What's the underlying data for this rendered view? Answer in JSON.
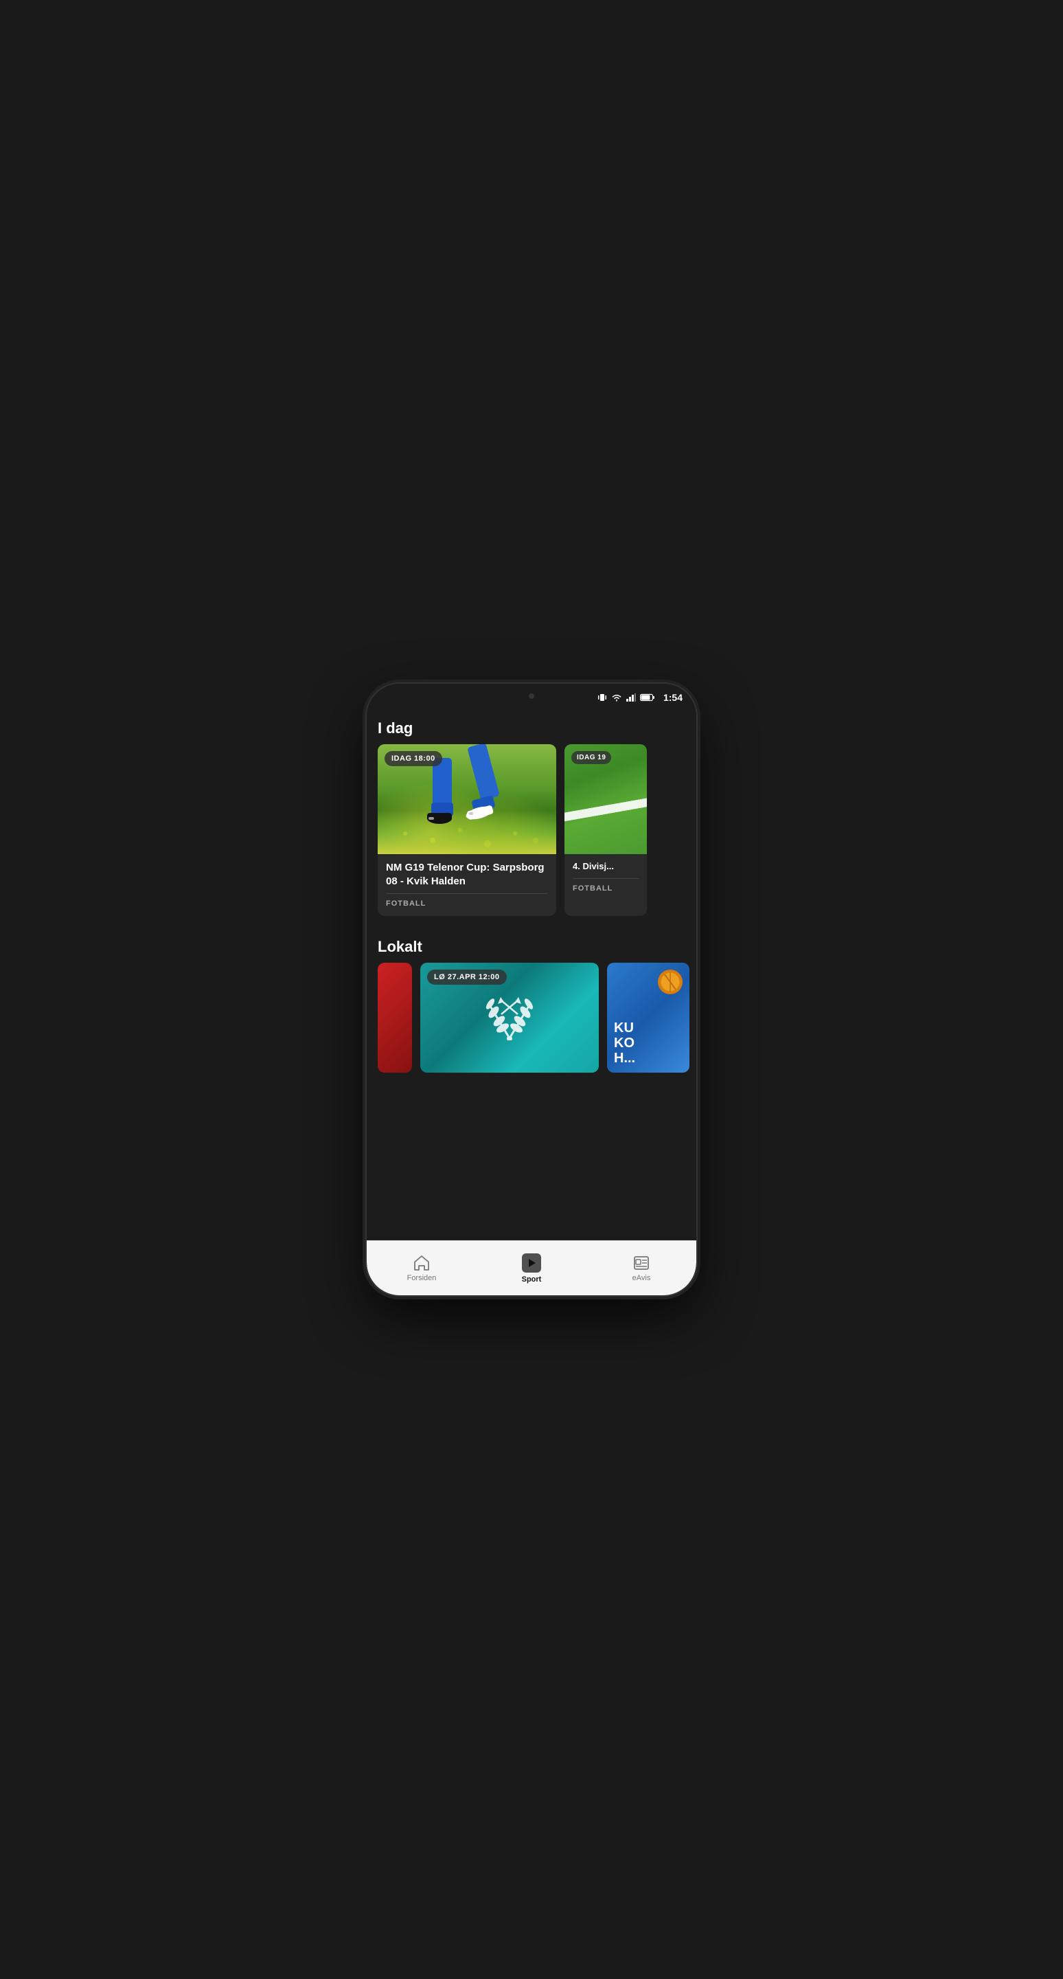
{
  "statusBar": {
    "time": "1:54",
    "battery": "79"
  },
  "sections": {
    "today": {
      "label": "I dag",
      "cards": [
        {
          "id": "card-1",
          "timeBadge": "IDAG 18:00",
          "title": "NM G19 Telenor Cup: Sarpsborg 08 - Kvik Halden",
          "category": "FOTBALL",
          "imageType": "football1"
        },
        {
          "id": "card-2",
          "timeBadge": "IDAG 19",
          "title": "4. Divisj...",
          "category": "FOTBALL",
          "imageType": "football2"
        }
      ]
    },
    "local": {
      "label": "Lokalt",
      "cards": [
        {
          "id": "lokalt-1",
          "timeBadge": "LØ 27.APR 12:00",
          "title": "",
          "imageType": "wreath"
        },
        {
          "id": "lokalt-2",
          "title": "KU KO H...",
          "imageType": "football-blue"
        }
      ]
    }
  },
  "bottomNav": {
    "items": [
      {
        "id": "forsiden",
        "label": "Forsiden",
        "icon": "home",
        "active": false
      },
      {
        "id": "sport",
        "label": "Sport",
        "icon": "play",
        "active": true
      },
      {
        "id": "eavis",
        "label": "eAvis",
        "icon": "newspaper",
        "active": false
      }
    ]
  }
}
